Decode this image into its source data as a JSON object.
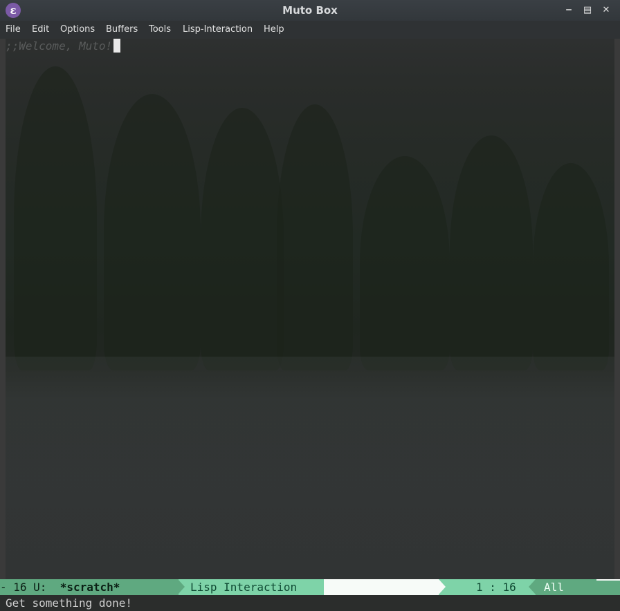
{
  "window": {
    "title": "Muto Box",
    "icon": "emacs-icon",
    "app_icon_glyph": "ε",
    "controls": {
      "minimize": "‒",
      "maximize": "▤",
      "close": "✕"
    }
  },
  "menubar": {
    "items": [
      {
        "label": "File"
      },
      {
        "label": "Edit"
      },
      {
        "label": "Options"
      },
      {
        "label": "Buffers"
      },
      {
        "label": "Tools"
      },
      {
        "label": "Lisp-Interaction"
      },
      {
        "label": "Help"
      }
    ]
  },
  "buffer": {
    "lines": [
      ";;Welcome, Muto!"
    ]
  },
  "modeline": {
    "status": "- 16 U:  ",
    "buffer_name": "*scratch*",
    "major_mode": "Lisp Interaction",
    "position": "1 : 16",
    "percent": "All"
  },
  "echo_area": {
    "message": "Get something done!"
  },
  "colors": {
    "modeline_dark": "#5fa980",
    "modeline_light": "#7ed3a8",
    "modeline_blank": "#f7fbf8",
    "comment": "#5a5c5c",
    "titlebar": "#3a3f44"
  }
}
